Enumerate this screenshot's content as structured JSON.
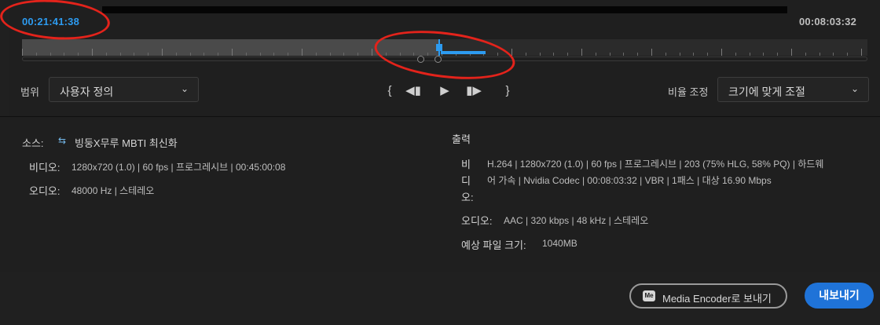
{
  "header": {
    "current_time": "00:21:41:38",
    "duration": "00:08:03:32"
  },
  "timeline": {
    "playhead_fraction": 0.493,
    "range_fraction": [
      0.495,
      0.548
    ]
  },
  "controls": {
    "range_label": "범위",
    "range_value": "사용자 정의",
    "scale_label": "비율 조정",
    "scale_value": "크기에 맞게 조절"
  },
  "transport": {
    "mark_in": "{",
    "step_back": "◀▮",
    "play": "▶",
    "step_forward": "▮▶",
    "mark_out": "}"
  },
  "source": {
    "label": "소스:",
    "name": "빙둥X무루 MBTI 최신화",
    "video_label": "비디오:",
    "video_value": "1280x720 (1.0) | 60 fps | 프로그레시브 | 00:45:00:08",
    "audio_label": "오디오:",
    "audio_value": "48000 Hz | 스테레오"
  },
  "output": {
    "title": "출력",
    "video_label_lines": [
      "비",
      "디",
      "오:"
    ],
    "video_value_lines": [
      "H.264 | 1280x720 (1.0) | 60 fps | 프로그레시브 | 203 (75% HLG, 58% PQ) | 하드웨",
      "어 가속 | Nvidia Codec | 00:08:03:32 | VBR | 1패스 | 대상 16.90 Mbps"
    ],
    "audio_label": "오디오:",
    "audio_value": "AAC | 320 kbps | 48 kHz | 스테레오",
    "size_label": "예상 파일 크기:",
    "size_value": "1040MB"
  },
  "bottom": {
    "media_encoder_badge": "Me",
    "media_encoder_label": "Media Encoder로 보내기",
    "export_label": "내보내기"
  },
  "colors": {
    "accent": "#2d9bf0",
    "annotation": "#e3231b",
    "background": "#1f1f1f"
  }
}
